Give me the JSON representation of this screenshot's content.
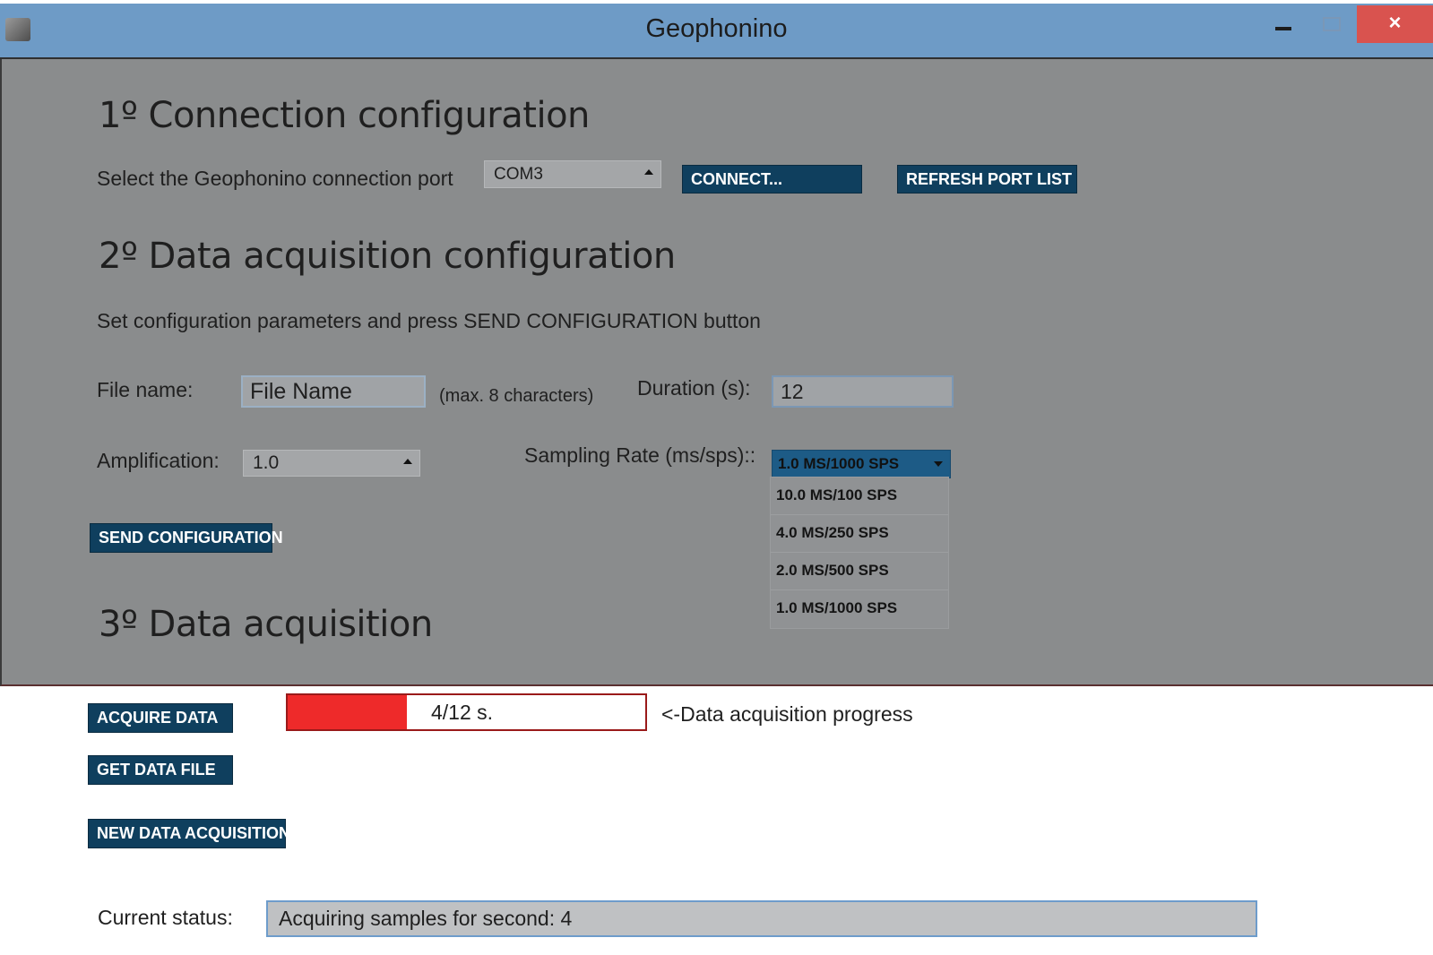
{
  "window": {
    "title": "Geophonino",
    "close_glyph": "×"
  },
  "section1": {
    "heading": "1º Connection configuration",
    "port_label": "Select the Geophonino connection port",
    "port_value": "COM3",
    "connect_label": "CONNECT...",
    "refresh_label": "REFRESH PORT LIST"
  },
  "section2": {
    "heading": "2º Data acquisition configuration",
    "instructions": "Set configuration parameters and press SEND CONFIGURATION button",
    "file_name_label": "File name:",
    "file_name_value": "File Name",
    "file_name_hint": "(max. 8 characters)",
    "duration_label": "Duration (s):",
    "duration_value": "12",
    "amplification_label": "Amplification:",
    "amplification_value": "1.0",
    "sampling_label": "Sampling Rate (ms/sps)::",
    "sampling_selected": "1.0 MS/1000 SPS",
    "sampling_options": [
      "10.0 MS/100 SPS",
      "4.0 MS/250 SPS",
      "2.0 MS/500 SPS",
      "1.0 MS/1000 SPS"
    ],
    "send_label": "SEND CONFIGURATION"
  },
  "section3": {
    "heading": "3º Data acquisition",
    "acquire_label": "ACQUIRE DATA",
    "get_file_label": "GET DATA FILE",
    "new_acq_label": "NEW DATA ACQUISITION",
    "progress_text": "4/12 s.",
    "progress_fraction": 0.333,
    "progress_color": "#ee2a2a",
    "progress_caption": "<-Data acquisition progress",
    "status_label": "Current status:",
    "status_value": "Acquiring samples for second: 4"
  },
  "colors": {
    "titlebar": "#6e9bc6",
    "button": "#0f3f5e",
    "dimmed_background": "#8a8c8d"
  }
}
